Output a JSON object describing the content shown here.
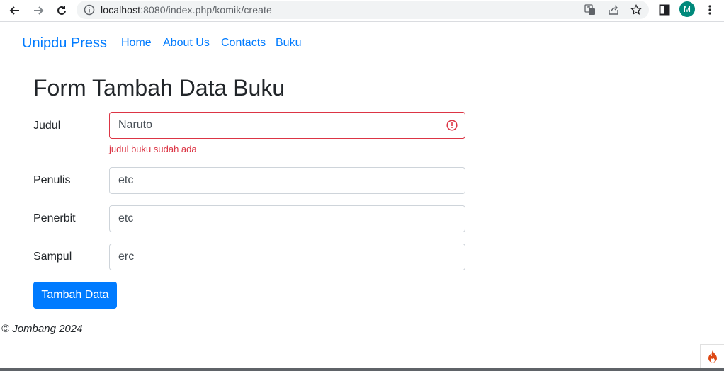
{
  "browser": {
    "url_host": "localhost",
    "url_path": ":8080/index.php/komik/create",
    "profile_initial": "M"
  },
  "navbar": {
    "brand": "Unipdu Press",
    "links": [
      "Home",
      "About Us",
      "Contacts",
      "Buku"
    ]
  },
  "form": {
    "title": "Form Tambah Data Buku",
    "fields": [
      {
        "label": "Judul",
        "value": "Naruto",
        "error": "judul buku sudah ada"
      },
      {
        "label": "Penulis",
        "value": "etc"
      },
      {
        "label": "Penerbit",
        "value": "etc"
      },
      {
        "label": "Sampul",
        "value": "erc"
      }
    ],
    "submit_label": "Tambah Data"
  },
  "footer": {
    "text": "© Jombang 2024"
  },
  "colors": {
    "primary": "#007bff",
    "danger": "#dc3545",
    "avatar": "#00897b"
  }
}
